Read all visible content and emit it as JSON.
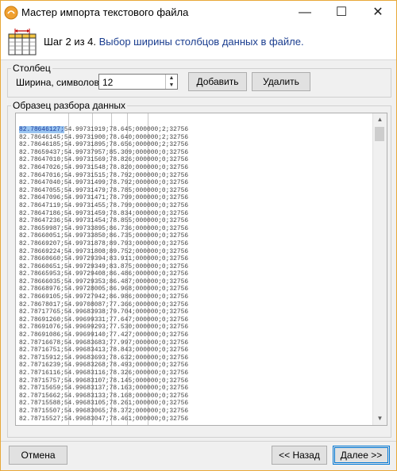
{
  "window": {
    "title": "Мастер импорта текстового файла",
    "minimize_glyph": "—",
    "maximize_glyph": "☐",
    "close_glyph": "✕"
  },
  "header": {
    "step": "Шаг 2 из 4.",
    "description": "Выбор ширины столбцов данных в файле."
  },
  "column_group": {
    "legend": "Столбец",
    "width_label": "Ширина, символов:",
    "width_value": "12",
    "add_label": "Добавить",
    "delete_label": "Удалить"
  },
  "sample_group": {
    "legend": "Образец разбора данных",
    "selected_cell": "82.78646127;",
    "rows": [
      "82.78646127;54.99731919;78.645;000000;2;32756",
      "82.78646145;54.99731900;78.640;000000;2;32756",
      "82.78646185;54.99731895;78.656;000000;2;32756",
      "82.78659437;54.99737957;85.309;000000;0;32756",
      "82.78647010;54.99731569;78.826;000000;0;32756",
      "82.78647026;54.99731548;78.820;000000;0;32756",
      "82.78647016;54.99731515;78.792;000000;0;32756",
      "82.78647040;54.99731499;78.792;000000;0;32756",
      "82.78647055;54.99731479;78.785;000000;0;32756",
      "82.78647096;54.99731471;78.799;000000;0;32756",
      "82.78647119;54.99731455;78.799;000000;0;32756",
      "82.78647186;54.99731459;78.834;000000;0;32756",
      "82.78647236;54.99731454;78.855;000000;0;32756",
      "82.78659987;54.99733895;86.736;000000;0;32756",
      "82.78660051;54.99733850;86.735;000000;0;32756",
      "82.78669207;54.99731878;89.793;000000;0;32756",
      "82.78669224;54.99731808;89.752;000000;0;32756",
      "82.78660660;54.99729394;83.911;000000;0;32756",
      "82.78660651;54.99729349;83.875;000000;0;32756",
      "82.78665953;54.99729408;86.486;000000;0;32756",
      "82.78666035;54.99729353;86.487;000000;0;32756",
      "82.78668976;54.99728005;86.968;000000;0;32756",
      "82.78669105;54.99727942;86.986;000000;0;32756",
      "82.78678017;54.99708087;77.366;000000;0;32756",
      "82.78717765;54.99683938;79.704;000000;0;32756",
      "82.78691260;54.99699331;77.647;000000;0;32756",
      "82.78691076;54.99699293;77.530;000000;0;32756",
      "82.78691086;54.99699140;77.427;000000;0;32756",
      "82.78716678;54.99683683;77.997;000000;0;32756",
      "82.78716751;54.99683413;78.843;000000;0;32756",
      "82.78715912;54.99683693;78.632;000000;0;32756",
      "82.78716239;54.99683268;78.493;000000;0;32756",
      "82.78716116;54.99683116;78.326;000000;0;32756",
      "82.78715757;54.99683107;78.145;000000;0;32756",
      "82.78715659;54.99683137;78.163;000000;0;32756",
      "82.78715662;54.99683133;78.168;000000;0;32756",
      "82.78715588;54.99683105;78.261;000000;0;32756",
      "82.78715507;54.99683065;78.372;000000;0;32756",
      "82.78715527;54.99683047;78.461;000000;0;32756"
    ]
  },
  "footer": {
    "cancel_label": "Отмена",
    "back_label": "<< Назад",
    "next_label": "Далее >>"
  },
  "colors": {
    "window_border": "#e8a838",
    "step_description": "#1a3d8f",
    "selection": "#99c4f0",
    "default_button_border": "#0078d7"
  },
  "icons": {
    "app": "orange-app-icon",
    "wizard_step": "column-width-icon",
    "minimize": "minimize-icon",
    "maximize": "maximize-icon",
    "close": "close-icon"
  }
}
